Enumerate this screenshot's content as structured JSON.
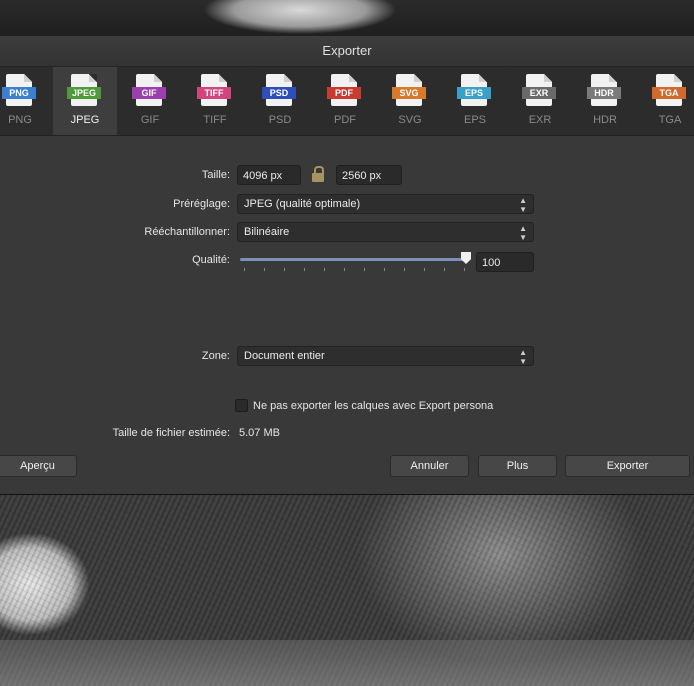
{
  "dialog": {
    "title": "Exporter"
  },
  "formats": [
    {
      "tag": "PNG",
      "label": "PNG",
      "color": "#3b7fd0",
      "selected": false
    },
    {
      "tag": "JPEG",
      "label": "JPEG",
      "color": "#4f9a3a",
      "selected": true
    },
    {
      "tag": "GIF",
      "label": "GIF",
      "color": "#9b3fae",
      "selected": false
    },
    {
      "tag": "TIFF",
      "label": "TIFF",
      "color": "#d0457e",
      "selected": false
    },
    {
      "tag": "PSD",
      "label": "PSD",
      "color": "#2f4fb8",
      "selected": false
    },
    {
      "tag": "PDF",
      "label": "PDF",
      "color": "#c93a32",
      "selected": false
    },
    {
      "tag": "SVG",
      "label": "SVG",
      "color": "#d77a2a",
      "selected": false
    },
    {
      "tag": "EPS",
      "label": "EPS",
      "color": "#3aa0c8",
      "selected": false
    },
    {
      "tag": "EXR",
      "label": "EXR",
      "color": "#6a6a6a",
      "selected": false
    },
    {
      "tag": "HDR",
      "label": "HDR",
      "color": "#7a7a7a",
      "selected": false
    },
    {
      "tag": "TGA",
      "label": "TGA",
      "color": "#d06a2c",
      "selected": false
    }
  ],
  "settings": {
    "size_label": "Taille:",
    "width": "4096 px",
    "height": "2560 px",
    "preset_label": "Préréglage:",
    "preset_value": "JPEG (qualité optimale)",
    "resample_label": "Rééchantillonner:",
    "resample_value": "Bilinéaire",
    "quality_label": "Qualité:",
    "quality_value": "100",
    "quality_level": 1.0,
    "area_label": "Zone:",
    "area_value": "Document entier",
    "checkbox_label": "Ne pas exporter les calques avec Export persona",
    "checkbox_checked": false,
    "filesize_label": "Taille de fichier estimée:",
    "filesize_value": "5.07 MB"
  },
  "buttons": {
    "preview": "Aperçu",
    "cancel": "Annuler",
    "more": "Plus",
    "export": "Exporter"
  }
}
